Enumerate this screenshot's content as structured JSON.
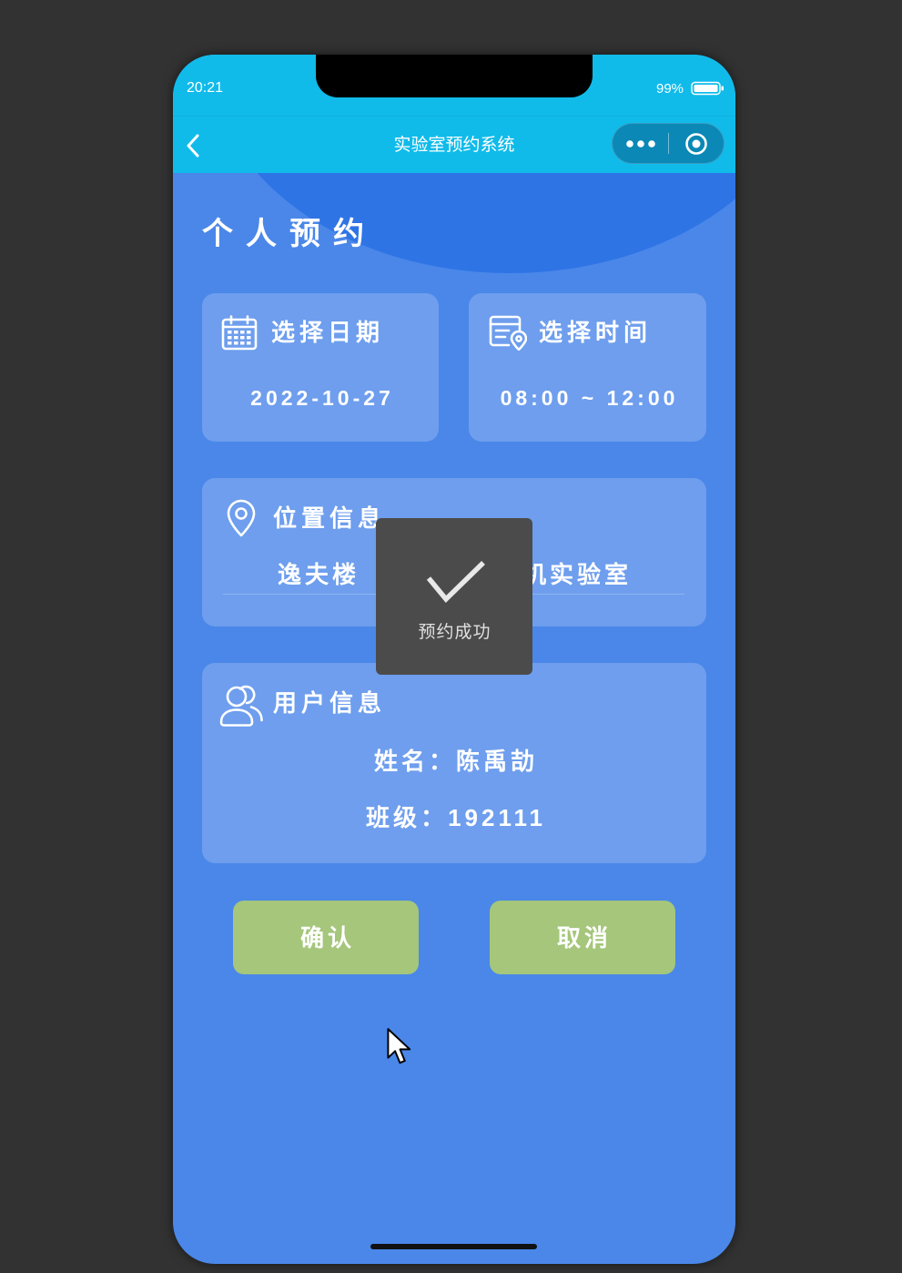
{
  "status_bar": {
    "time": "20:21",
    "battery_level": "99%",
    "battery_icon": "battery-icon"
  },
  "nav_bar": {
    "back_icon": "chevron-left-icon",
    "title": "实验室预约系统",
    "more_icon": "more-dots-icon",
    "home_icon": "target-circle-icon"
  },
  "page": {
    "title": "个人预约"
  },
  "date_card": {
    "icon": "calendar-icon",
    "label": "选择日期",
    "value": "2022-10-27"
  },
  "time_card": {
    "icon": "calendar-location-icon",
    "label": "选择时间",
    "value": "08:00 ~ 12:00"
  },
  "location_card": {
    "icon": "location-pin-icon",
    "label": "位置信息",
    "value_left": "逸夫楼",
    "value_right": "机实验室"
  },
  "user_card": {
    "icon": "user-icon",
    "label": "用户信息",
    "name_label": "姓名：",
    "name_value": "陈禹劼",
    "class_label": "班级：",
    "class_value": "192111"
  },
  "actions": {
    "confirm_label": "确认",
    "cancel_label": "取消"
  },
  "toast": {
    "icon": "checkmark-icon",
    "message": "预约成功"
  },
  "cursor": {
    "icon": "mouse-pointer-icon"
  },
  "colors": {
    "page_background": "#323232",
    "header_cyan": "#10bbea",
    "capsule_teal": "#0b88b5",
    "content_blue": "#4a87e9",
    "arc_blue": "#2f74e5",
    "card_blue": "#6e9eed",
    "button_green": "#a5c67b",
    "toast_gray": "#4b4b4b"
  }
}
